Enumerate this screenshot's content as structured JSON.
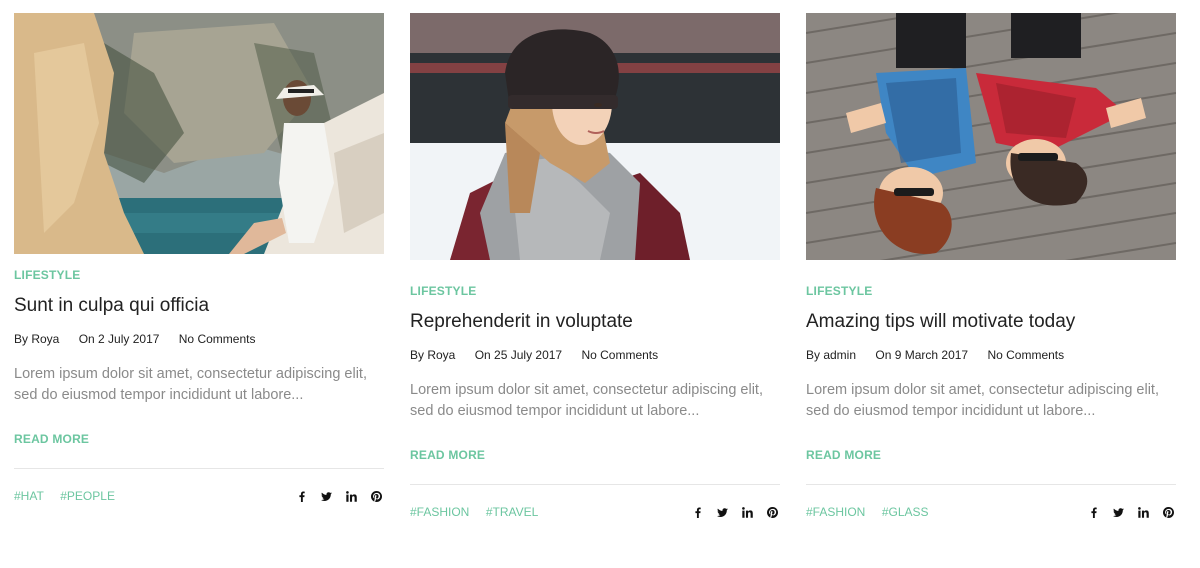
{
  "posts": [
    {
      "category": "LIFESTYLE",
      "title": "Sunt in culpa qui officia",
      "author": "By Roya",
      "date": "On 2 July 2017",
      "comments": "No Comments",
      "excerpt": "Lorem ipsum dolor sit amet, consectetur adipiscing elit, sed do eiusmod tempor incididunt ut labore...",
      "read_more": "READ MORE",
      "tags": [
        "#HAT",
        "#PEOPLE"
      ],
      "image_icon": "woman-on-cliff-photo"
    },
    {
      "category": "LIFESTYLE",
      "title": "Reprehenderit in voluptate",
      "author": "By Roya",
      "date": "On 25 July 2017",
      "comments": "No Comments",
      "excerpt": "Lorem ipsum dolor sit amet, consectetur adipiscing elit, sed do eiusmod tempor incididunt ut labore...",
      "read_more": "READ MORE",
      "tags": [
        "#FASHION",
        "#TRAVEL"
      ],
      "image_icon": "woman-with-beanie-photo"
    },
    {
      "category": "LIFESTYLE",
      "title": "Amazing tips will motivate today",
      "author": "By admin",
      "date": "On 9 March 2017",
      "comments": "No Comments",
      "excerpt": "Lorem ipsum dolor sit amet, consectetur adipiscing elit, sed do eiusmod tempor incididunt ut labore...",
      "read_more": "READ MORE",
      "tags": [
        "#FASHION",
        "#GLASS"
      ],
      "image_icon": "friends-lying-on-deck-photo"
    }
  ],
  "social_icons": [
    "facebook-icon",
    "twitter-icon",
    "linkedin-icon",
    "pinterest-icon"
  ],
  "colors": {
    "accent": "#6cc6a0",
    "text": "#222222",
    "muted": "#8a8a8a",
    "divider": "#e6e6e6"
  }
}
